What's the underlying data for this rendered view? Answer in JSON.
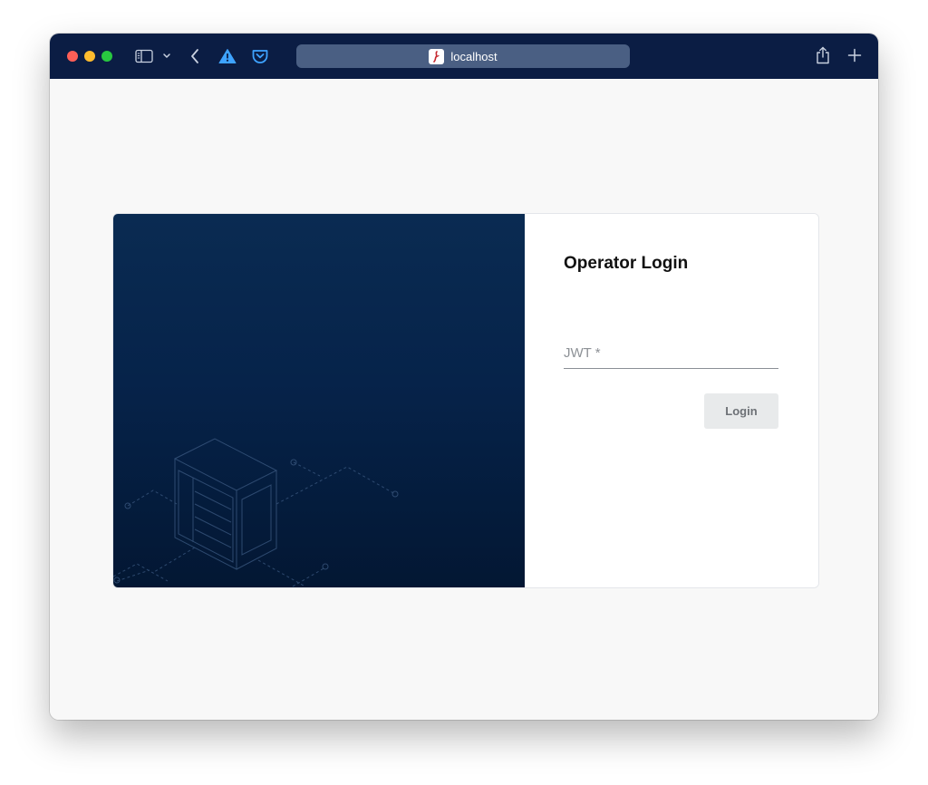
{
  "browser": {
    "address_text": "localhost"
  },
  "login": {
    "title": "Operator Login",
    "jwt_label": "JWT *",
    "login_button": "Login"
  },
  "colors": {
    "titlebar": "#0b1d44",
    "address_bar": "#4a5f83",
    "panel_top": "#0a2b52",
    "panel_bottom": "#031733",
    "button_bg": "#e8eaeb"
  }
}
